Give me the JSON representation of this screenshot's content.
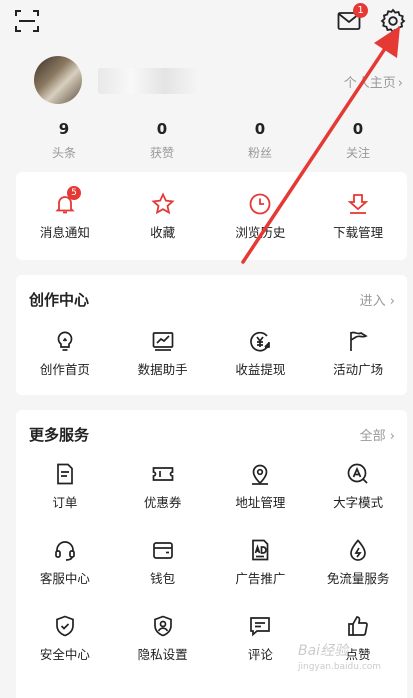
{
  "header": {
    "mail_badge": "1"
  },
  "profile": {
    "homepage_label": "个人主页"
  },
  "stats": [
    {
      "num": "9",
      "label": "头条"
    },
    {
      "num": "0",
      "label": "获赞"
    },
    {
      "num": "0",
      "label": "粉丝"
    },
    {
      "num": "0",
      "label": "关注"
    }
  ],
  "quick": {
    "notif_badge": "5",
    "items": [
      "消息通知",
      "收藏",
      "浏览历史",
      "下载管理"
    ]
  },
  "creator": {
    "title": "创作中心",
    "more": "进入",
    "items": [
      "创作首页",
      "数据助手",
      "收益提现",
      "活动广场"
    ]
  },
  "services": {
    "title": "更多服务",
    "more": "全部",
    "items": [
      "订单",
      "优惠券",
      "地址管理",
      "大字模式",
      "客服中心",
      "钱包",
      "广告推广",
      "免流量服务",
      "安全中心",
      "隐私设置",
      "评论",
      "点赞"
    ]
  },
  "watermark": {
    "text": "Bai经验",
    "sub": "jingyan.baidu.com"
  },
  "colors": {
    "accent": "#e53935",
    "arrow": "#e53935"
  }
}
